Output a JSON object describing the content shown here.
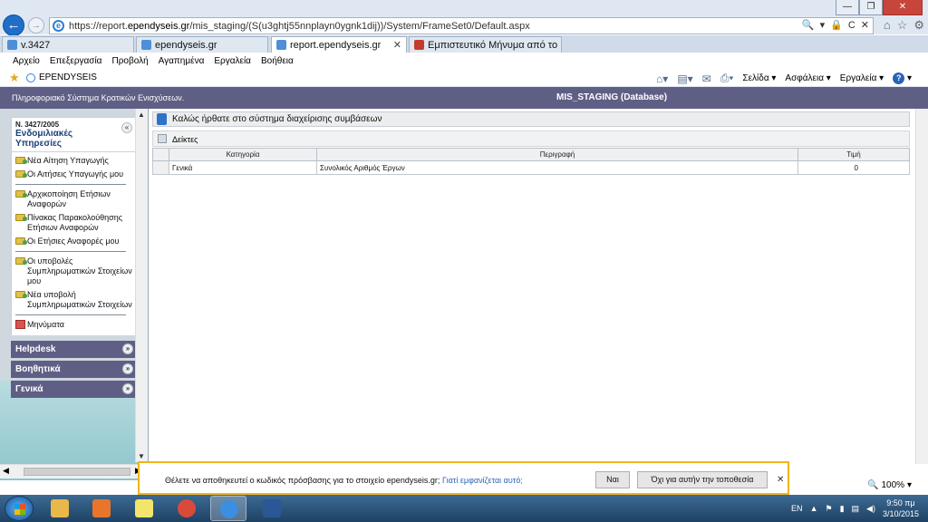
{
  "browser": {
    "url_prefix": "https://report.",
    "url_domain": "ependyseis.gr",
    "url_rest": "/mis_staging/(S(u3ghtj55nnplayn0ygnk1dij))/System/FrameSet0/Default.aspx",
    "url_buttons": [
      "🔍",
      "▾",
      "🔒",
      "C",
      "✕"
    ],
    "window_buttons": [
      "—",
      "❐",
      "✕"
    ],
    "right_icons": [
      "⌂",
      "☆",
      "⚙"
    ],
    "tabs": [
      {
        "label": "v.3427",
        "color": "#4d8fd8"
      },
      {
        "label": "ependyseis.gr",
        "color": "#4d8fd8"
      },
      {
        "label": "report.ependyseis.gr",
        "color": "#4d8fd8"
      },
      {
        "label": "Εμπιστευτικό Μήνυμα από το ...",
        "color": "#c23b2e"
      }
    ],
    "menu": [
      "Αρχείο",
      "Επεξεργασία",
      "Προβολή",
      "Αγαπημένα",
      "Εργαλεία",
      "Βοήθεια"
    ],
    "favorite": "EPENDYSEIS",
    "commands": [
      "Σελίδα ▾",
      "Ασφάλεια ▾",
      "Εργαλεία ▾"
    ],
    "help_icon": "?",
    "zoom": "100%"
  },
  "app": {
    "header_left": "Πληροφοριακό Σύστημα Κρατικών Ενισχύσεων.",
    "header_right": "MIS_STAGING (Database)"
  },
  "sidebar": {
    "code": "Ν. 3427/2005",
    "title": "Ενδομιλιακές Υπηρεσίες",
    "groups": [
      [
        "Νέα Αίτηση Υπαγωγής",
        "Οι Αιτήσεις Υπαγωγής μου"
      ],
      [
        "Αρχικοποίηση Ετήσιων Αναφορών",
        "Πίνακας Παρακολούθησης Ετήσιων Αναφορών",
        "Οι Ετήσιες Αναφορές μου"
      ],
      [
        "Οι υποβολές Συμπληρωματικών Στοιχείων μου",
        "Νέα υποβολή Συμπληρωματικών Στοιχείων"
      ],
      [
        "Μηνύματα"
      ]
    ],
    "sections": [
      "Helpdesk",
      "Βοηθητικά",
      "Γενικά"
    ],
    "chev_up": "«",
    "chev_down": "»"
  },
  "main": {
    "welcome": "Καλώς ήρθατε στο σύστημα διαχείρισης συμβάσεων",
    "panel_title": "Δείκτες",
    "columns": [
      "Κατηγορία",
      "Περιγραφή",
      "Τιμή"
    ],
    "rows": [
      [
        "Γενικά",
        "Συνολικός Αριθμός Έργων",
        "0"
      ]
    ]
  },
  "prompt": {
    "message": "Θέλετε να αποθηκευτεί ο κωδικός πρόσβασης για το στοιχείο ependyseis.gr;",
    "link": "Γιατί εμφανίζεται αυτό;",
    "yes": "Ναι",
    "no": "Όχι για αυτήν την τοποθεσία",
    "close": "✕"
  },
  "taskbar": {
    "apps": [
      {
        "name": "explorer",
        "color": "#e8b84a"
      },
      {
        "name": "media-player",
        "color": "#e8752b"
      },
      {
        "name": "sticky-notes",
        "color": "#f3e46b"
      },
      {
        "name": "chrome",
        "color": "#d94a3b"
      },
      {
        "name": "internet-explorer",
        "color": "#3c8ee0",
        "active": true
      },
      {
        "name": "word",
        "color": "#2b5797"
      }
    ],
    "lang": "EN",
    "time": "9:50 πμ",
    "date": "3/10/2015"
  }
}
